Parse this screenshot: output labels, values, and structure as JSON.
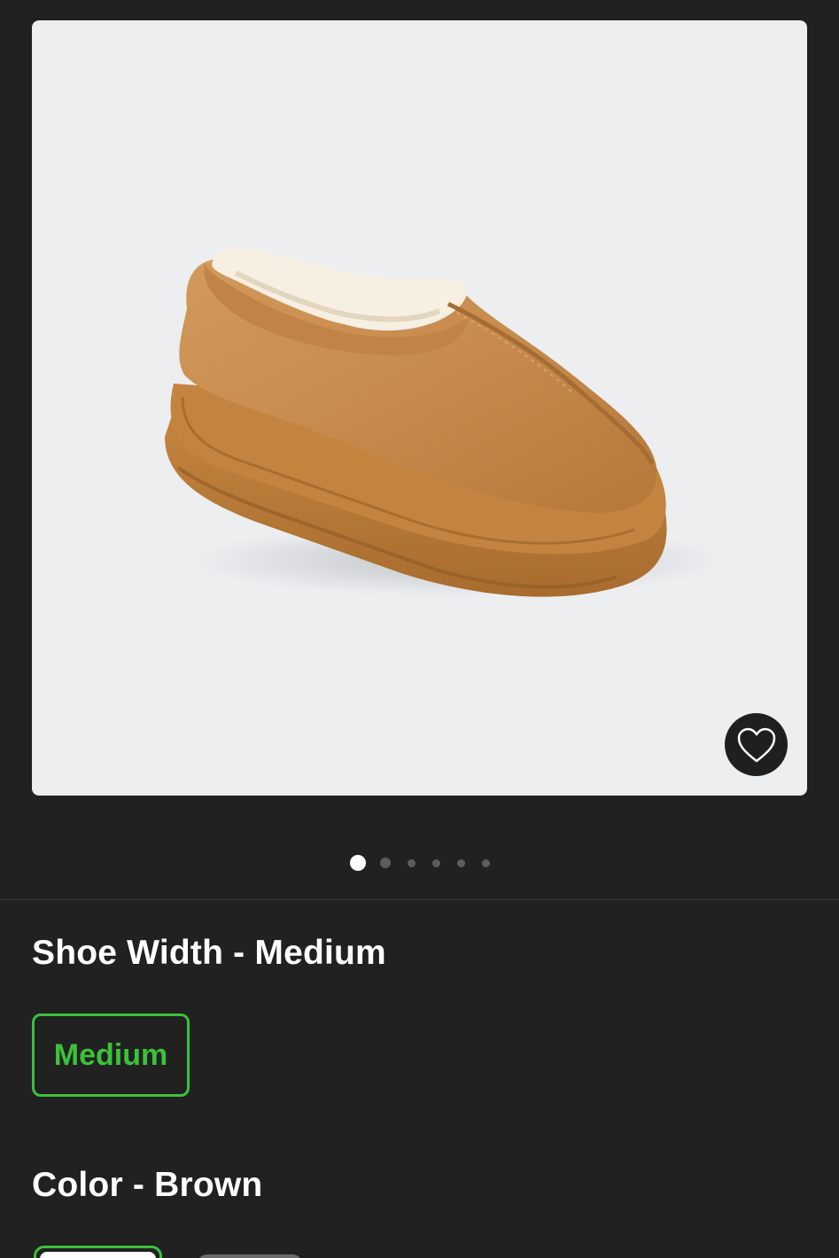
{
  "product": {
    "image_alt": "Toddler slip-on suede slipper with sherpa lining",
    "favorite_icon": "heart-outline-icon"
  },
  "carousel": {
    "total_images": 6,
    "active_index": 0
  },
  "shoe_width": {
    "title": "Shoe Width - Medium",
    "options": [
      {
        "label": "Medium",
        "selected": true
      }
    ]
  },
  "color": {
    "title": "Color - Brown",
    "swatches": [
      {
        "name": "Brown",
        "selected": true
      },
      {
        "name": "Other",
        "selected": false
      }
    ]
  },
  "theme": {
    "background": "#212121",
    "accent_green": "#3cc13b",
    "image_bg": "#eceef0"
  }
}
